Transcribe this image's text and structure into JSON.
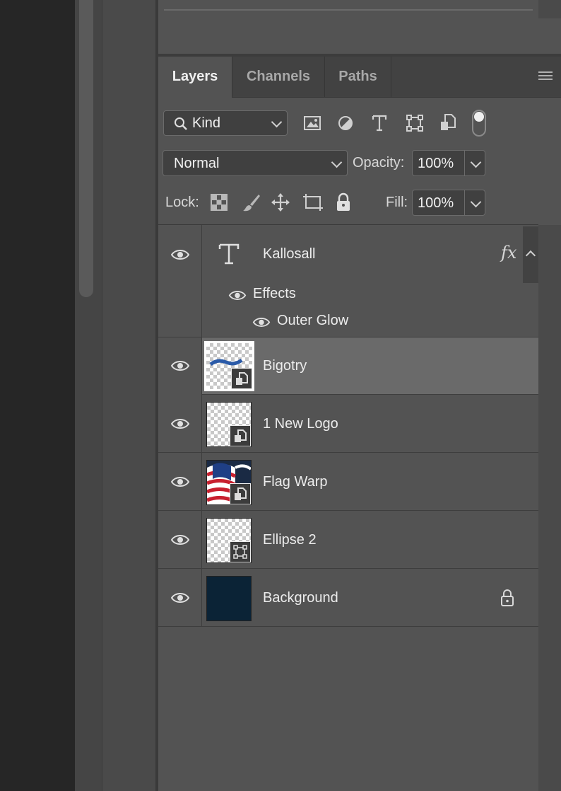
{
  "tabs": [
    "Layers",
    "Channels",
    "Paths"
  ],
  "filter": {
    "kind_label": "Kind"
  },
  "blend": {
    "mode": "Normal",
    "opacity_label": "Opacity:",
    "opacity_value": "100%"
  },
  "lock": {
    "label": "Lock:",
    "fill_label": "Fill:",
    "fill_value": "100%"
  },
  "layers": [
    {
      "name": "Kallosall",
      "type": "text",
      "fx": "fx",
      "effects_label": "Effects",
      "effect": "Outer Glow"
    },
    {
      "name": "Bigotry",
      "type": "smart-object",
      "selected": true
    },
    {
      "name": "1 New Logo",
      "type": "smart-object"
    },
    {
      "name": "Flag Warp",
      "type": "smart-object"
    },
    {
      "name": "Ellipse 2",
      "type": "shape"
    },
    {
      "name": "Background",
      "type": "background",
      "locked": true
    }
  ],
  "colors": {
    "panel": "#535353",
    "selected_row": "#6a6a6a",
    "background_fill": "#0b2336"
  }
}
